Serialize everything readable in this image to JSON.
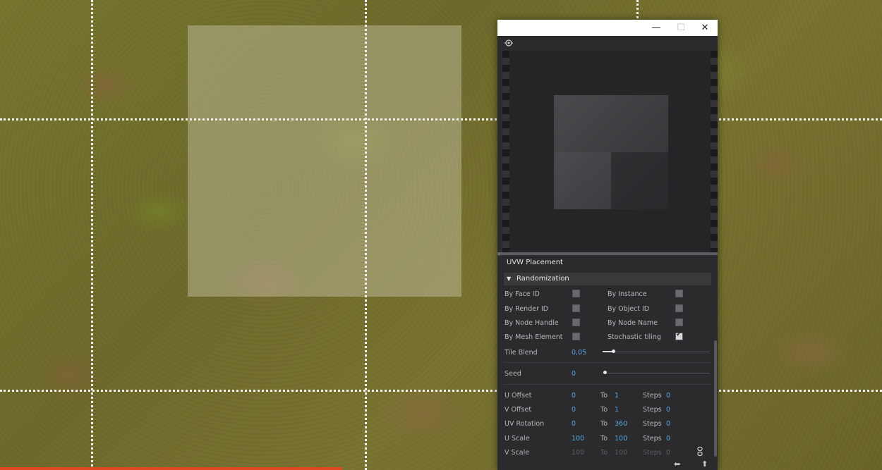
{
  "window": {
    "minimize_glyph": "—",
    "maximize_glyph": "☐",
    "close_glyph": "✕"
  },
  "toolbar": {
    "preview_icon": "preview-eye-icon"
  },
  "panel": {
    "section_title": "UVW Placement",
    "randomization_header": "Randomization"
  },
  "randomization": {
    "by_face_id": "By Face ID",
    "by_instance": "By Instance",
    "by_render_id": "By Render ID",
    "by_object_id": "By Object ID",
    "by_node_handle": "By Node Handle",
    "by_node_name": "By Node Name",
    "by_mesh_element": "By Mesh Element",
    "stochastic_tiling": "Stochastic tiling",
    "stochastic_checked": true
  },
  "tile_blend": {
    "label": "Tile Blend",
    "value": "0,05",
    "fraction": 0.1
  },
  "seed": {
    "label": "Seed",
    "value": "0",
    "fraction": 0.0
  },
  "uv_rows": [
    {
      "label": "U Offset",
      "from": "0",
      "to_label": "To",
      "to": "1",
      "steps_label": "Steps",
      "steps": "0"
    },
    {
      "label": "V Offset",
      "from": "0",
      "to_label": "To",
      "to": "1",
      "steps_label": "Steps",
      "steps": "0"
    },
    {
      "label": "UV Rotation",
      "from": "0",
      "to_label": "To",
      "to": "360",
      "steps_label": "Steps",
      "steps": "0"
    },
    {
      "label": "U Scale",
      "from": "100",
      "to_label": "To",
      "to": "100",
      "steps_label": "Steps",
      "steps": "0"
    },
    {
      "label": "V Scale",
      "from": "100",
      "to_label": "To",
      "to": "100",
      "steps_label": "Steps",
      "steps": "0"
    }
  ],
  "footer": {
    "left_icon": "arrow-left-icon",
    "right_icon": "arrow-up-icon"
  },
  "colors": {
    "accent_value": "#5aa7e0",
    "timeline": "#e0481f"
  }
}
